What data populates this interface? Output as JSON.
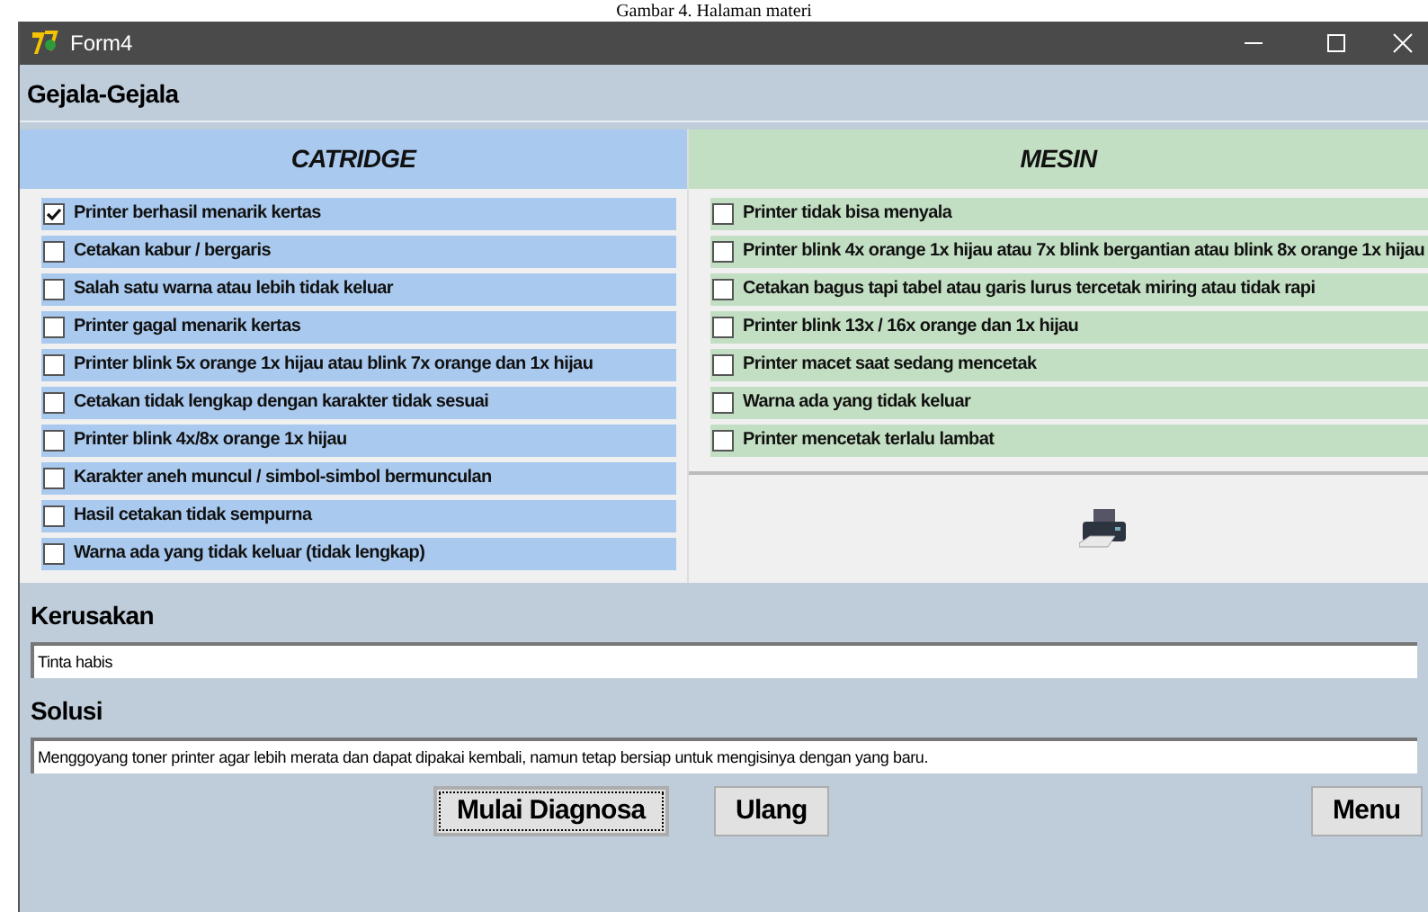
{
  "caption": "Gambar 4. Halaman materi",
  "window": {
    "title": "Form4"
  },
  "group_title": "Gejala-Gejala",
  "columns": [
    {
      "title": "CATRIDGE",
      "color": "#a9c9ee",
      "items": [
        {
          "label": "Printer berhasil menarik kertas",
          "checked": true
        },
        {
          "label": "Cetakan kabur / bergaris",
          "checked": false
        },
        {
          "label": "Salah satu warna atau lebih tidak keluar",
          "checked": false
        },
        {
          "label": "Printer gagal menarik kertas",
          "checked": false
        },
        {
          "label": "Printer blink 5x orange 1x hijau atau blink 7x orange dan 1x hijau",
          "checked": false
        },
        {
          "label": "Cetakan tidak lengkap dengan karakter tidak sesuai",
          "checked": false
        },
        {
          "label": "Printer blink 4x/8x orange 1x hijau",
          "checked": false
        },
        {
          "label": "Karakter aneh muncul / simbol-simbol bermunculan",
          "checked": false
        },
        {
          "label": "Hasil cetakan tidak sempurna",
          "checked": false
        },
        {
          "label": "Warna ada yang tidak keluar (tidak lengkap)",
          "checked": false
        }
      ]
    },
    {
      "title": "MESIN",
      "color": "#c3dfc3",
      "items": [
        {
          "label": "Printer tidak bisa menyala",
          "checked": false
        },
        {
          "label": "Printer blink 4x orange 1x hijau atau 7x blink bergantian atau blink 8x orange 1x hijau",
          "checked": false
        },
        {
          "label": "Cetakan bagus tapi tabel atau garis lurus tercetak miring atau tidak rapi",
          "checked": false
        },
        {
          "label": "Printer blink 13x / 16x orange dan 1x hijau",
          "checked": false
        },
        {
          "label": "Printer macet saat sedang mencetak",
          "checked": false
        },
        {
          "label": "Warna ada yang tidak keluar",
          "checked": false
        },
        {
          "label": "Printer mencetak terlalu lambat",
          "checked": false
        }
      ]
    }
  ],
  "fields": [
    {
      "label": "Kerusakan",
      "value": "Tinta habis"
    },
    {
      "label": "Solusi",
      "value": "Menggoyang toner printer agar lebih merata dan dapat dipakai kembali, namun tetap bersiap untuk mengisinya dengan yang baru."
    }
  ],
  "buttons": [
    {
      "label": "Mulai Diagnosa",
      "focused": true
    },
    {
      "label": "Ulang",
      "focused": false
    },
    {
      "label": "Menu",
      "focused": false
    }
  ]
}
